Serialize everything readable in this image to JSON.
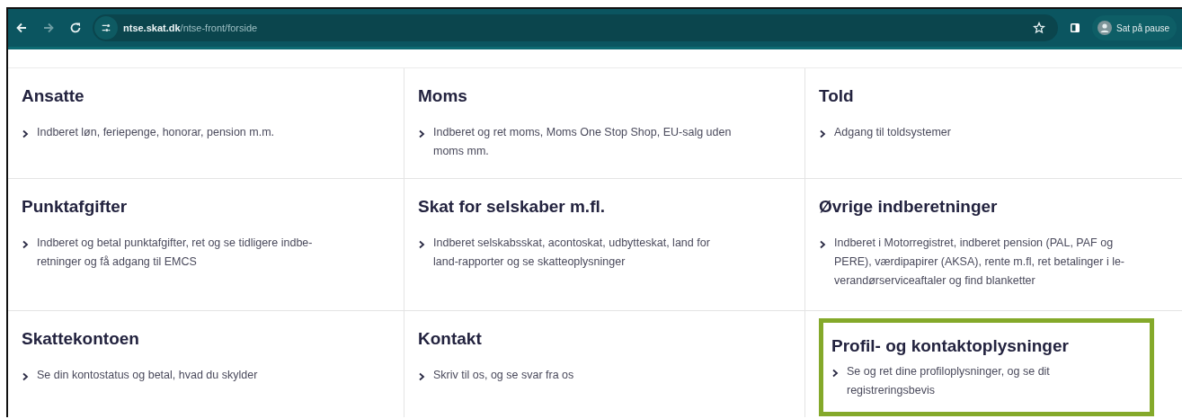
{
  "browser": {
    "url": "**ntse.skat.dk**/ntse-front/forside",
    "profile": "Sat på pause"
  },
  "cards": [
    {
      "title": "Ansatte",
      "link": "Indberet løn, feriepenge, honorar, pension m.m.",
      "highlighted": false
    },
    {
      "title": "Moms",
      "link": "Indberet og ret moms, Moms One Stop Shop, EU-salg uden\nmoms mm.",
      "highlighted": false
    },
    {
      "title": "Told",
      "link": "Adgang til toldsystemer",
      "highlighted": false
    },
    {
      "title": "Punktafgifter",
      "link": "Indberet og betal punktafgifter, ret og se tidligere indbe-\nretninger og få adgang til EMCS",
      "highlighted": false
    },
    {
      "title": "Skat for selskaber m.fl.",
      "link": "Indberet selskabsskat, acontoskat, udbytteskat, land for\nland-rapporter og se skatteoplysninger",
      "highlighted": false
    },
    {
      "title": "Øvrige indberetninger",
      "link": "Indberet i Motorregistret, indberet pension (PAL, PAF og\nPERE), værdipapirer (AKSA), rente m.fl, ret betalinger i le-\nverandørserviceaftaler og find blanketter",
      "highlighted": false
    },
    {
      "title": "Skattekontoen",
      "link": "Se din kontostatus og betal, hvad du skylder",
      "highlighted": false
    },
    {
      "title": "Kontakt",
      "link": "Skriv til os, og se svar fra os",
      "highlighted": false
    },
    {
      "title": "Profil- og kontaktoplysninger",
      "link": "Se og ret dine profiloplysninger, og se dit\nregistreringsbevis",
      "highlighted": true
    }
  ]
}
